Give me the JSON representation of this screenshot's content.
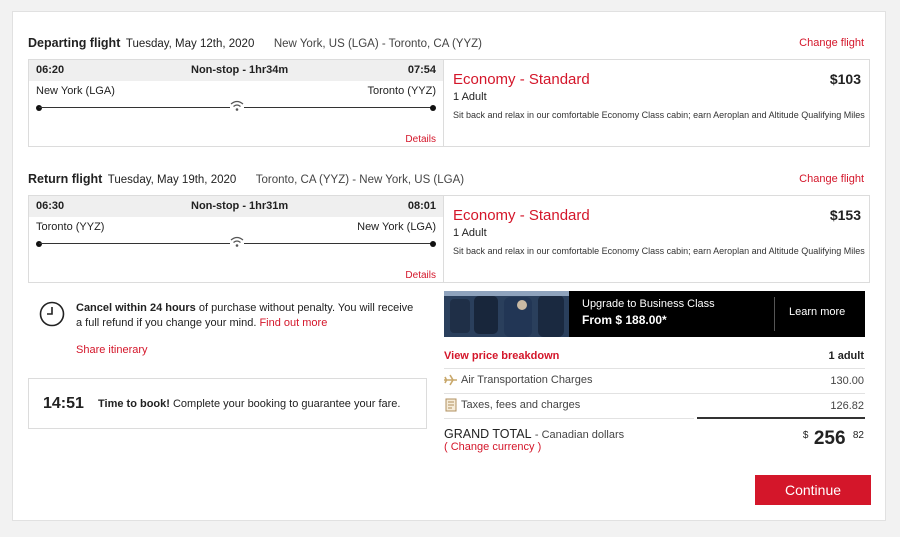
{
  "departing": {
    "label": "Departing flight",
    "date": "Tuesday, May 12th, 2020",
    "route": "New York, US (LGA) - Toronto, CA (YYZ)",
    "change": "Change flight",
    "dep_time": "06:20",
    "duration": "Non-stop - 1hr34m",
    "arr_time": "07:54",
    "from": "New York (LGA)",
    "to": "Toronto (YYZ)",
    "details": "Details",
    "fare": "Economy - Standard",
    "price": "$103",
    "pax": "1 Adult",
    "desc": "Sit back and relax in our comfortable Economy Class cabin; earn Aeroplan and Altitude Qualifying Miles"
  },
  "return": {
    "label": "Return flight",
    "date": "Tuesday, May 19th, 2020",
    "route": "Toronto, CA (YYZ) - New York, US (LGA)",
    "change": "Change flight",
    "dep_time": "06:30",
    "duration": "Non-stop - 1hr31m",
    "arr_time": "08:01",
    "from": "Toronto (YYZ)",
    "to": "New York (LGA)",
    "details": "Details",
    "fare": "Economy - Standard",
    "price": "$153",
    "pax": "1 Adult",
    "desc": "Sit back and relax in our comfortable Economy Class cabin; earn Aeroplan and Altitude Qualifying Miles"
  },
  "cancel": {
    "bold": "Cancel within 24 hours",
    "text": " of purchase without penalty. You will receive a full refund if you change your mind. ",
    "link": "Find out more",
    "share": "Share itinerary"
  },
  "timer": {
    "time": "14:51",
    "bold": "Time to book!",
    "text": " Complete your booking to guarantee your fare."
  },
  "upgrade": {
    "title": "Upgrade to Business Class",
    "price": "From $ 188.00*",
    "cta": "Learn more"
  },
  "breakdown": {
    "link": "View price breakdown",
    "adults": "1 adult",
    "rows": [
      {
        "label": "Air Transportation Charges",
        "value": "130.00",
        "icon": "plane-icon"
      },
      {
        "label": "Taxes, fees and charges",
        "value": "126.82",
        "icon": "receipt-icon"
      }
    ],
    "grand_label": "GRAND TOTAL",
    "currency": "- Canadian dollars",
    "change_currency": "Change currency",
    "paren_open": "(",
    "paren_close": ")",
    "dollar": "$",
    "total_main": "256",
    "total_cents": "82"
  },
  "continue": "Continue",
  "colors": {
    "accent": "#d4162a"
  }
}
